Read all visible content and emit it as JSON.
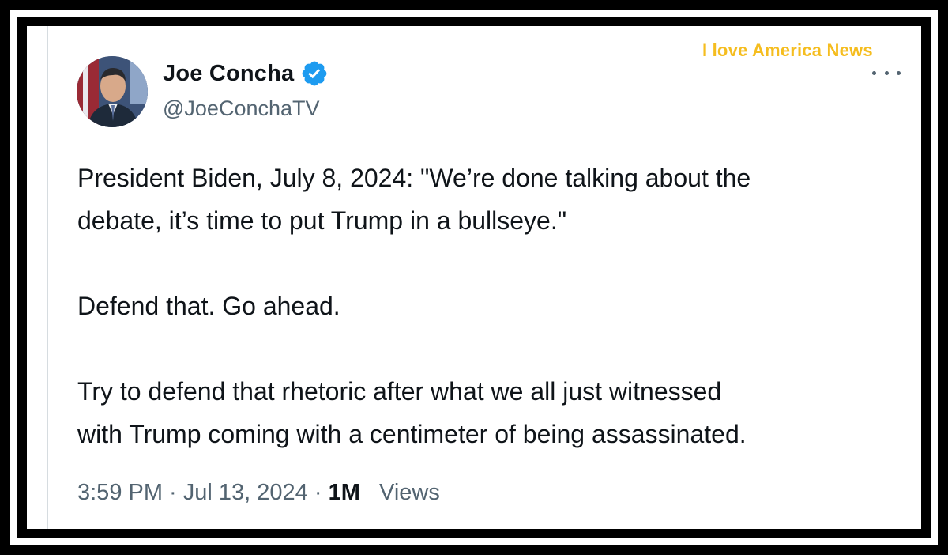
{
  "watermark": "I love America News",
  "tweet": {
    "author_name": "Joe Concha",
    "author_handle": "@JoeConchaTV",
    "paragraph_1_line_1": "President Biden, July 8, 2024: \"We’re done talking about the",
    "paragraph_1_line_2": "debate, it’s time to put Trump in a bullseye.\"",
    "paragraph_2": "Defend that. Go ahead.",
    "paragraph_3_line_1": "Try to defend that rhetoric after what we all just witnessed",
    "paragraph_3_line_2": "with Trump coming with a centimeter of being assassinated.",
    "time": "3:59 PM",
    "separator": " · ",
    "date": "Jul 13, 2024",
    "views_count": "1M",
    "views_label": "Views"
  },
  "colors": {
    "verified": "#1d9bf0",
    "watermark": "#f5bd1f",
    "secondary_text": "#536471",
    "primary_text": "#0f1419"
  },
  "icons": {
    "verified": "verified-badge-icon",
    "more": "more-options-icon"
  }
}
